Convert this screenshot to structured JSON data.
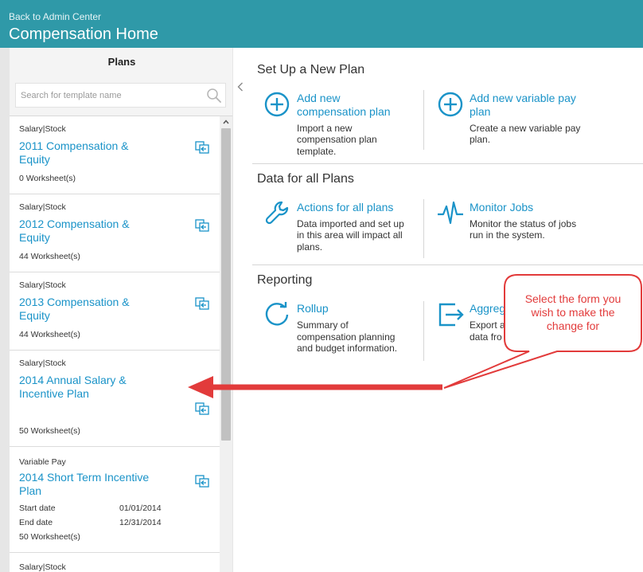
{
  "header": {
    "back_link": "Back to Admin Center",
    "title": "Compensation Home",
    "background": "#2f99a8"
  },
  "plans": {
    "title": "Plans",
    "search_placeholder": "Search for template name",
    "items": [
      {
        "category": "Salary|Stock",
        "name": "2011 Compensation & Equity",
        "worksheets": "0 Worksheet(s)"
      },
      {
        "category": "Salary|Stock",
        "name": "2012 Compensation & Equity",
        "worksheets": "44 Worksheet(s)"
      },
      {
        "category": "Salary|Stock",
        "name": "2013 Compensation & Equity",
        "worksheets": "44 Worksheet(s)"
      },
      {
        "category": "Salary|Stock",
        "name": "2014 Annual Salary & Incentive Plan",
        "worksheets": "50 Worksheet(s)"
      },
      {
        "category": "Variable Pay",
        "name": "2014 Short Term Incentive Plan",
        "start_label": "Start date",
        "start_value": "01/01/2014",
        "end_label": "End date",
        "end_value": "12/31/2014",
        "worksheets": "50 Worksheet(s)"
      },
      {
        "category": "Salary|Stock"
      }
    ]
  },
  "sections": [
    {
      "title": "Set Up a New Plan",
      "tiles": [
        {
          "icon": "plus-circle-icon",
          "title_line1": "Add new",
          "title_line2": "compensation plan",
          "desc": [
            "Import a new",
            "compensation plan",
            "template."
          ]
        },
        {
          "icon": "plus-circle-icon",
          "title_line1": "Add new variable pay",
          "title_line2": "plan",
          "desc": [
            "Create a new variable pay",
            "plan."
          ]
        }
      ]
    },
    {
      "title": "Data for all Plans",
      "tiles": [
        {
          "icon": "wrench-icon",
          "title_line1": "Actions for all plans",
          "desc": [
            "Data imported and set up",
            "in this area will impact all",
            "plans."
          ]
        },
        {
          "icon": "pulse-icon",
          "title_line1": "Monitor Jobs",
          "desc": [
            "Monitor the status of jobs",
            "run in the system."
          ]
        }
      ]
    },
    {
      "title": "Reporting",
      "tiles": [
        {
          "icon": "refresh-icon",
          "title_line1": "Rollup",
          "desc": [
            "Summary of",
            "compensation planning",
            "and budget information."
          ]
        },
        {
          "icon": "export-icon",
          "title_line1": "Aggreg",
          "desc": [
            "Export a",
            "data fro"
          ]
        }
      ]
    }
  ],
  "callout": {
    "lines": [
      "Select the form you",
      "wish to make the",
      "change for"
    ],
    "color": "#e23b3b"
  },
  "accent": "#1a93c8"
}
